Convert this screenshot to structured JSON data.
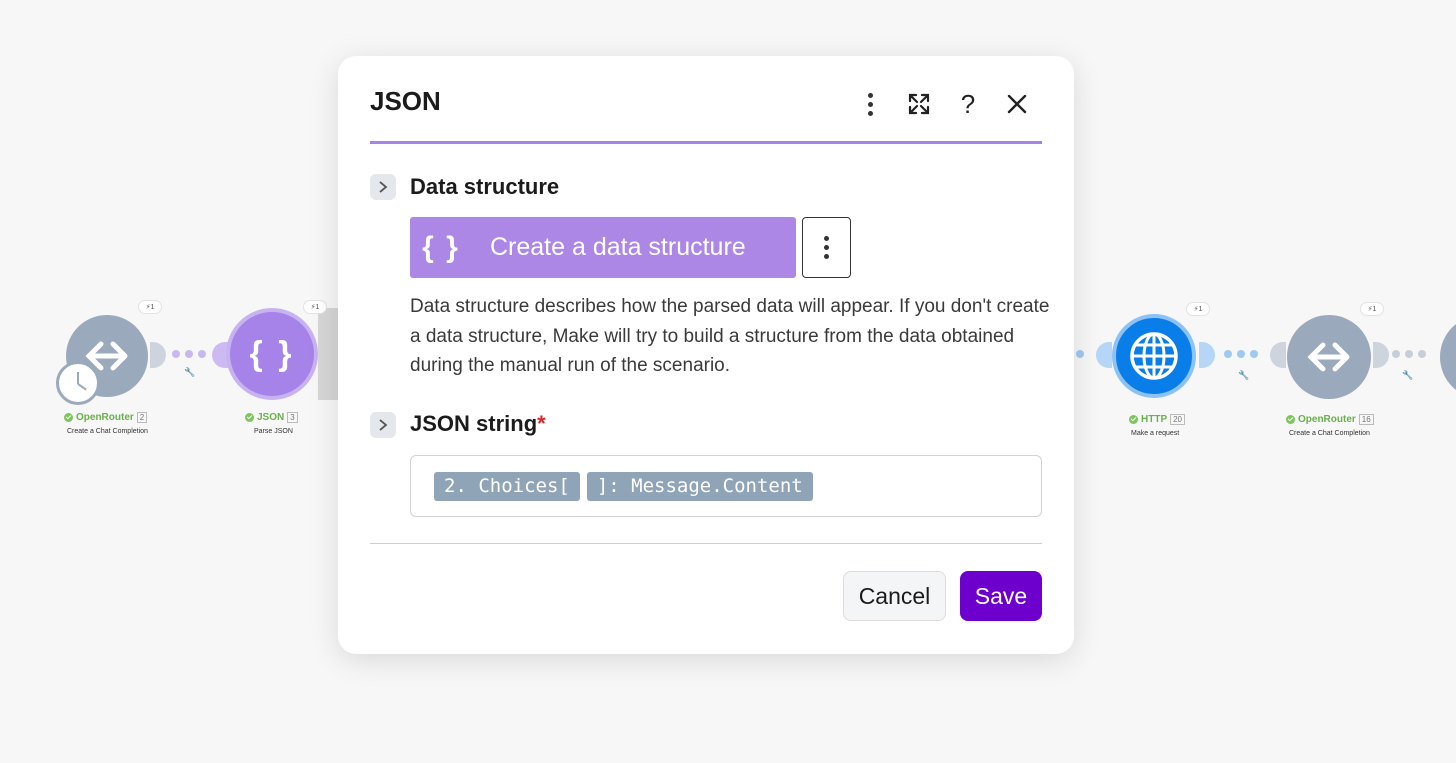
{
  "dialog": {
    "title": "JSON",
    "data_structure_label": "Data structure",
    "create_button_icon": "{ }",
    "create_button_label": "Create a data structure",
    "help_text": "Data structure describes how the parsed data will appear. If you don't create a data structure, Make will try to build a structure from the data obtained during the manual run of the scenario.",
    "json_string_label": "JSON string",
    "required_mark": "*",
    "json_string_tokens": [
      "2. Choices[",
      "]: Message.Content"
    ],
    "cancel_label": "Cancel",
    "save_label": "Save",
    "header_icons": [
      "more-vertical-icon",
      "expand-icon",
      "help-icon",
      "close-icon"
    ],
    "accent_color": "#a583e8",
    "save_color": "#6d00cc"
  },
  "canvas": {
    "modules": [
      {
        "name": "OpenRouter",
        "number": "2",
        "subtitle": "Create a Chat Completion",
        "badge": "1"
      },
      {
        "name": "JSON",
        "number": "3",
        "subtitle": "Parse JSON",
        "badge": "1"
      },
      {
        "name": "HTTP",
        "number": "20",
        "subtitle": "Make a request",
        "badge": "1"
      },
      {
        "name": "OpenRouter",
        "number": "16",
        "subtitle": "Create a Chat Completion",
        "badge": "1"
      }
    ]
  }
}
